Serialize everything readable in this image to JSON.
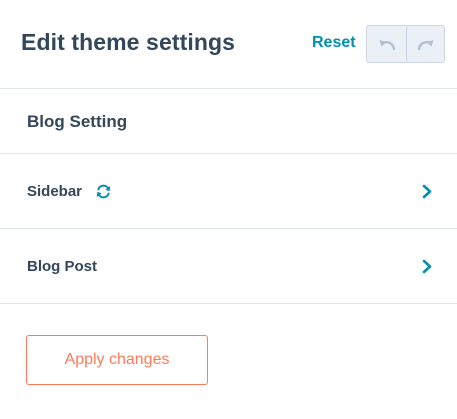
{
  "header": {
    "title": "Edit theme settings",
    "reset_label": "Reset",
    "undo_icon": "undo-icon",
    "redo_icon": "redo-icon"
  },
  "section": {
    "heading": "Blog Setting"
  },
  "rows": [
    {
      "label": "Sidebar",
      "status_icon": "sync-icon",
      "nav_icon": "chevron-right-icon"
    },
    {
      "label": "Blog Post",
      "nav_icon": "chevron-right-icon"
    }
  ],
  "footer": {
    "apply_label": "Apply changes"
  },
  "colors": {
    "text": "#33475b",
    "link": "#0091ae",
    "divider": "#dfe3eb",
    "button_bg": "#eaf0f6",
    "button_border": "#cbd6e2",
    "disabled_icon": "#b0c1d4",
    "accent": "#ff7a59"
  }
}
